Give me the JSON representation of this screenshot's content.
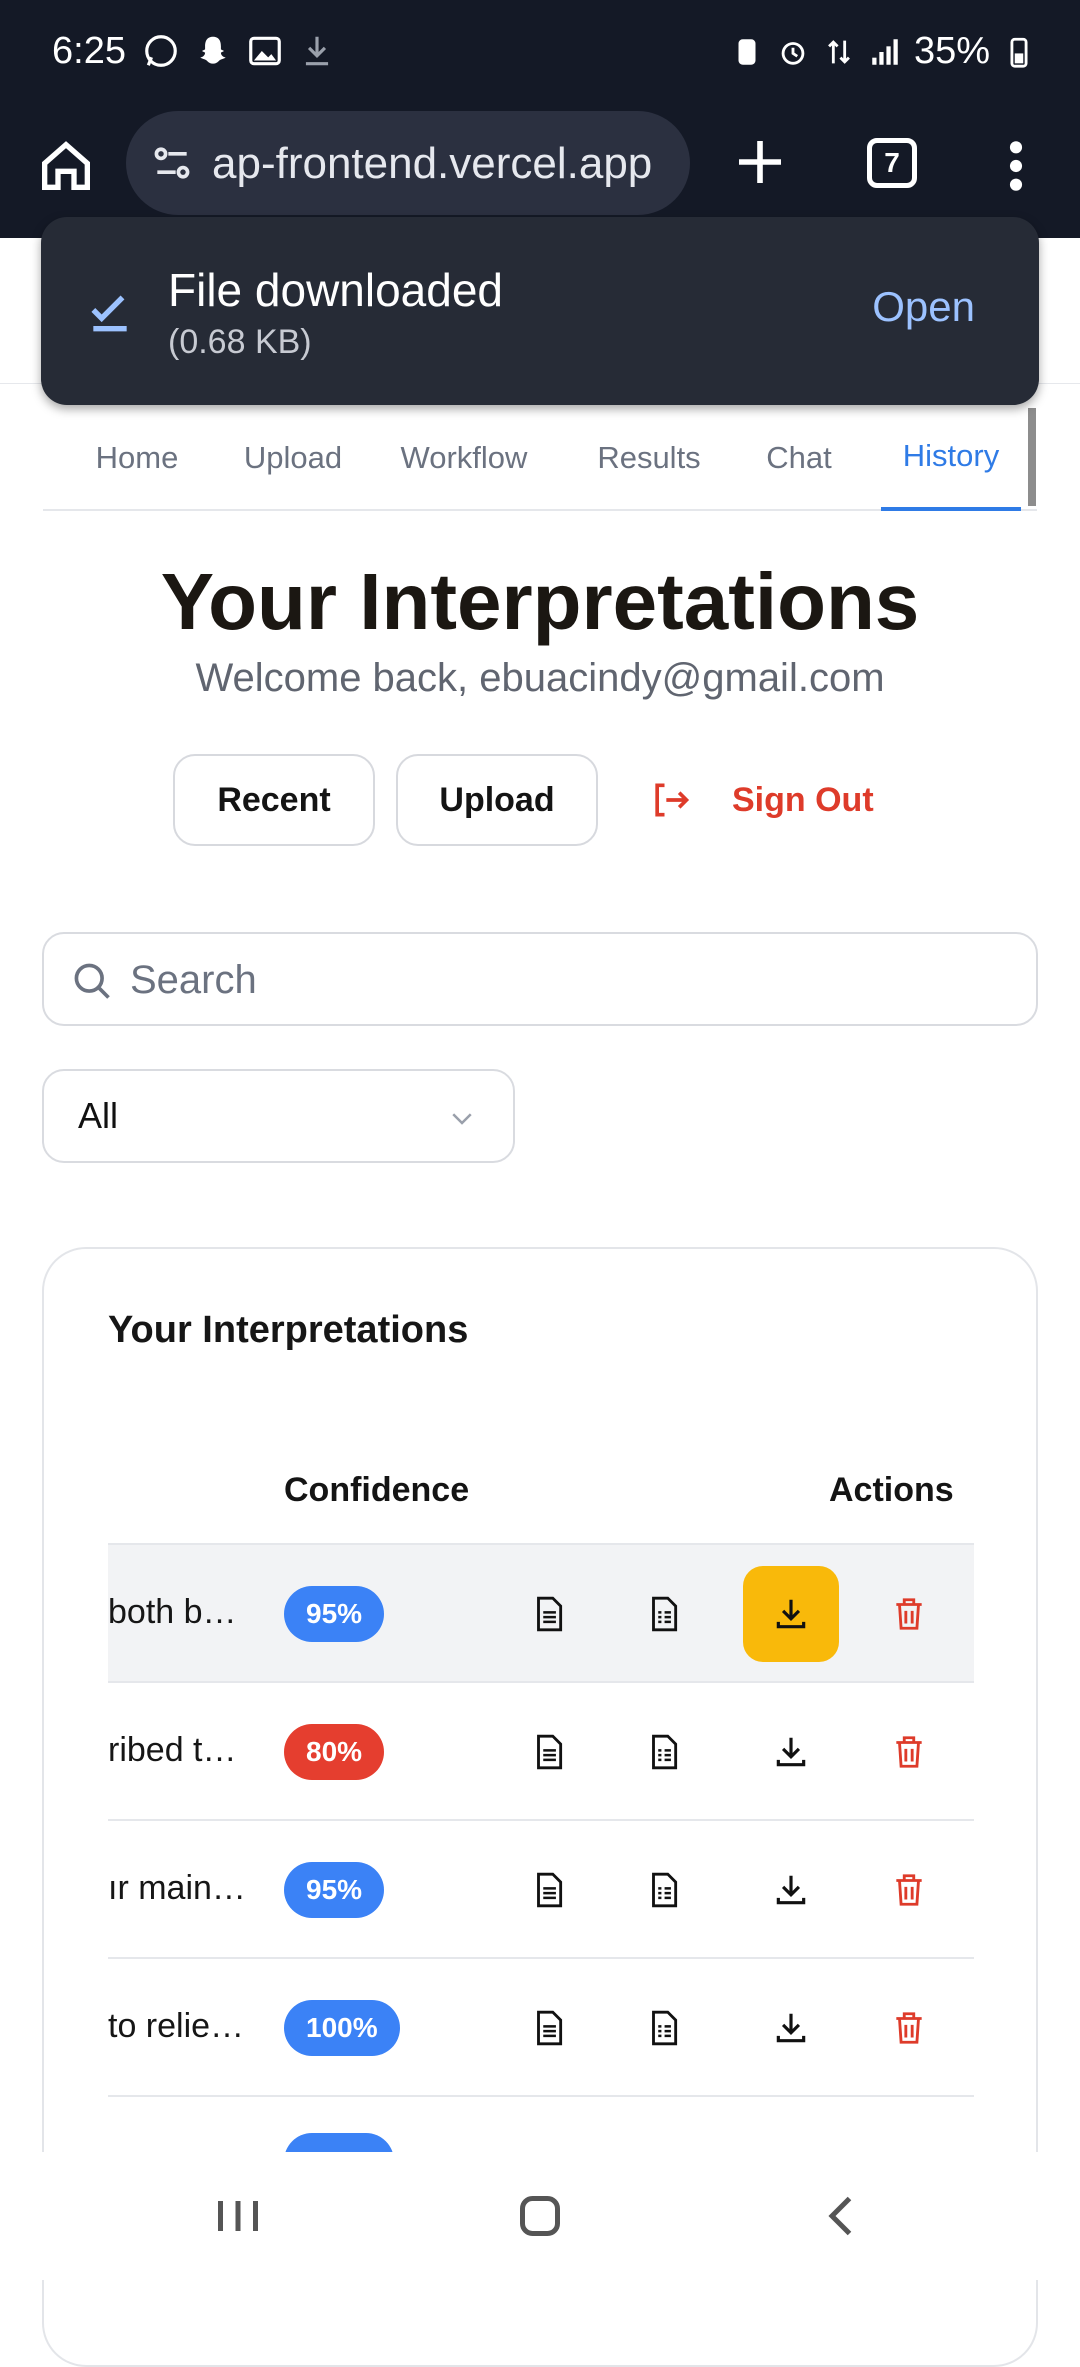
{
  "status_bar": {
    "time": "6:25",
    "battery": "35%"
  },
  "browser": {
    "url": "ap-frontend.vercel.app",
    "tab_count": "7"
  },
  "toast": {
    "title": "File downloaded",
    "subtitle": "(0.68 KB)",
    "action": "Open"
  },
  "nav_tabs": [
    {
      "label": "Home"
    },
    {
      "label": "Upload"
    },
    {
      "label": "Workflow"
    },
    {
      "label": "Results"
    },
    {
      "label": "Chat"
    },
    {
      "label": "History",
      "active": true
    }
  ],
  "header": {
    "title": "Your Interpretations",
    "welcome": "Welcome back, ebuacindy@gmail.com"
  },
  "buttons": {
    "recent": "Recent",
    "upload": "Upload",
    "sign_out": "Sign Out"
  },
  "search": {
    "placeholder": "Search",
    "value": ""
  },
  "filter": {
    "selected": "All"
  },
  "card": {
    "title": "Your Interpretations",
    "columns": {
      "confidence": "Confidence",
      "actions": "Actions"
    },
    "rows": [
      {
        "text": "both b…",
        "confidence": "95%",
        "badge_color": "#3b82f6"
      },
      {
        "text": "ribed t…",
        "confidence": "80%",
        "badge_color": "#e53e2f"
      },
      {
        "text": "ır main…",
        "confidence": "95%",
        "badge_color": "#3b82f6"
      },
      {
        "text": "to relie…",
        "confidence": "100%",
        "badge_color": "#3b82f6"
      }
    ]
  },
  "colors": {
    "accent": "#2f7be6",
    "danger": "#de3b2a",
    "highlight": "#f9b90a",
    "dark_bar": "#141926"
  }
}
